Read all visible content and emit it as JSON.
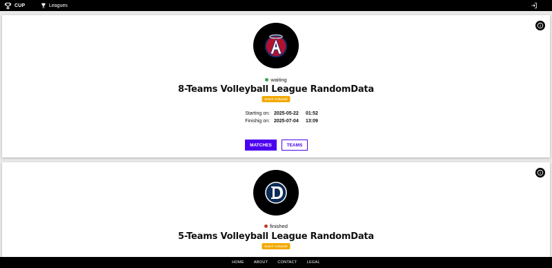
{
  "header": {
    "brand": "CUP",
    "nav_leagues": "Leagues"
  },
  "leagues": [
    {
      "status": "waiting",
      "status_color": "#3aa14a",
      "title": "8-Teams Volleyball League RandomData",
      "sport_badge": "Beach Volleyball",
      "starting_label": "Starting on:",
      "starting_date": "2025-05-22",
      "starting_time": "01:52",
      "finishing_label": "Finishig on:",
      "finishing_date": "2025-07-04",
      "finishing_time": "13:09",
      "matches_label": "MATCHES",
      "teams_label": "TEAMS",
      "logo_icon": "angels-logo-icon"
    },
    {
      "status": "finished",
      "status_color": "#c0392b",
      "title": "5-Teams Volleyball League RandomData",
      "sport_badge": "Beach Volleyball",
      "logo_icon": "tigers-logo-icon"
    }
  ],
  "footer": {
    "links": [
      "HOME",
      "ABOUT",
      "CONTACT",
      "LEGAL"
    ]
  },
  "colors": {
    "accent": "#4b00f0",
    "badge": "#f2a900"
  }
}
